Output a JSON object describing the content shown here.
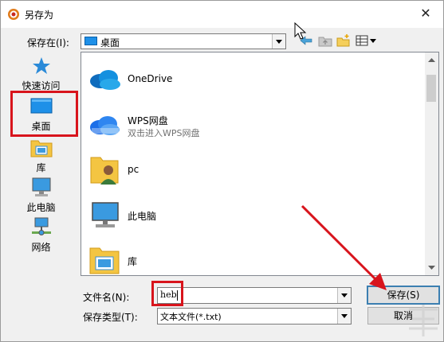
{
  "dialog": {
    "title": "另存为",
    "close_glyph": "✕"
  },
  "location": {
    "label": "保存在(I):",
    "value": "桌面"
  },
  "toolbar": {
    "icons": [
      "back-arrow-icon",
      "up-folder-icon",
      "new-folder-icon",
      "view-menu-icon"
    ]
  },
  "places": [
    {
      "label": "快速访问",
      "icon": "star-icon"
    },
    {
      "label": "桌面",
      "icon": "desktop-icon",
      "selected": true
    },
    {
      "label": "库",
      "icon": "library-icon"
    },
    {
      "label": "此电脑",
      "icon": "computer-icon"
    },
    {
      "label": "网络",
      "icon": "network-icon"
    }
  ],
  "files": [
    {
      "name": "OneDrive",
      "sub": "",
      "icon": "onedrive-cloud-icon"
    },
    {
      "name": "WPS网盘",
      "sub": "双击进入WPS网盘",
      "icon": "wps-cloud-icon"
    },
    {
      "name": "pc",
      "sub": "",
      "icon": "user-folder-icon"
    },
    {
      "name": "此电脑",
      "sub": "",
      "icon": "computer-icon"
    },
    {
      "name": "库",
      "sub": "",
      "icon": "library-folder-icon"
    }
  ],
  "filename": {
    "label": "文件名(N):",
    "value": "heb"
  },
  "filetype": {
    "label": "保存类型(T):",
    "value": "文本文件(*.txt)"
  },
  "buttons": {
    "save": "保存(S)",
    "cancel": "取消"
  },
  "colors": {
    "highlight": "#d8141c",
    "accent": "#0078d7",
    "arrow": "#d8141c"
  }
}
